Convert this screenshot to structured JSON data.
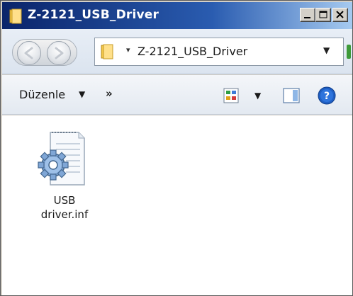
{
  "window": {
    "title": "Z-2121_USB_Driver"
  },
  "address": {
    "path": "Z-2121_USB_Driver"
  },
  "commandbar": {
    "organize_label": "Düzenle",
    "more_label": "»"
  },
  "files": [
    {
      "name_line1": "USB",
      "name_line2": "driver.inf",
      "icon": "settings-file-icon"
    }
  ],
  "colors": {
    "titlebar_start": "#0a246a",
    "titlebar_end": "#a6caf0",
    "help_blue": "#1f5fc4"
  }
}
